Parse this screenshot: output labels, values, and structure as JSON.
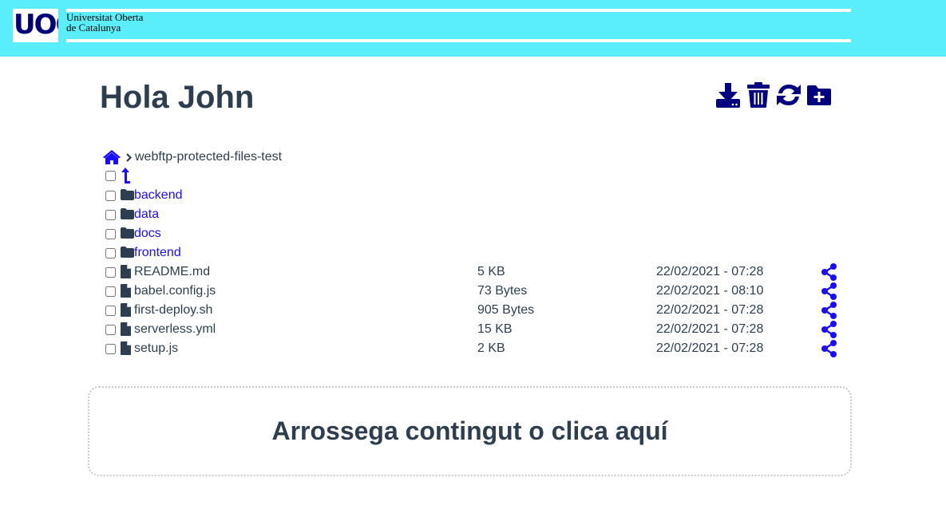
{
  "header": {
    "logo_text": "UOC",
    "brand_line1": "Universitat Oberta",
    "brand_line2": "de Catalunya",
    "bg_color": "#5aeefa"
  },
  "greeting": "Hola John",
  "toolbar": [
    {
      "icon": "download-icon"
    },
    {
      "icon": "trash-icon"
    },
    {
      "icon": "refresh-icon"
    },
    {
      "icon": "folder-plus-icon"
    }
  ],
  "breadcrumb": {
    "home_icon": "home-icon",
    "separator_icon": "chevron-right-icon",
    "path": "webftp-protected-files-test"
  },
  "folders": [
    {
      "name": "backend"
    },
    {
      "name": "data"
    },
    {
      "name": "docs"
    },
    {
      "name": "frontend"
    }
  ],
  "files": [
    {
      "name": "README.md",
      "size": "5 KB",
      "date": "22/02/2021 - 07:28"
    },
    {
      "name": "babel.config.js",
      "size": "73 Bytes",
      "date": "22/02/2021 - 08:10"
    },
    {
      "name": "first-deploy.sh",
      "size": "905 Bytes",
      "date": "22/02/2021 - 07:28"
    },
    {
      "name": "serverless.yml",
      "size": "15 KB",
      "date": "22/02/2021 - 07:28"
    },
    {
      "name": "setup.js",
      "size": "2 KB",
      "date": "22/02/2021 - 07:28"
    }
  ],
  "dropzone": {
    "label": "Arrossega contingut o clica aquí"
  },
  "colors": {
    "accent": "#1a0dff",
    "toolbar_icon": "#000080",
    "text": "#2c3e50"
  }
}
